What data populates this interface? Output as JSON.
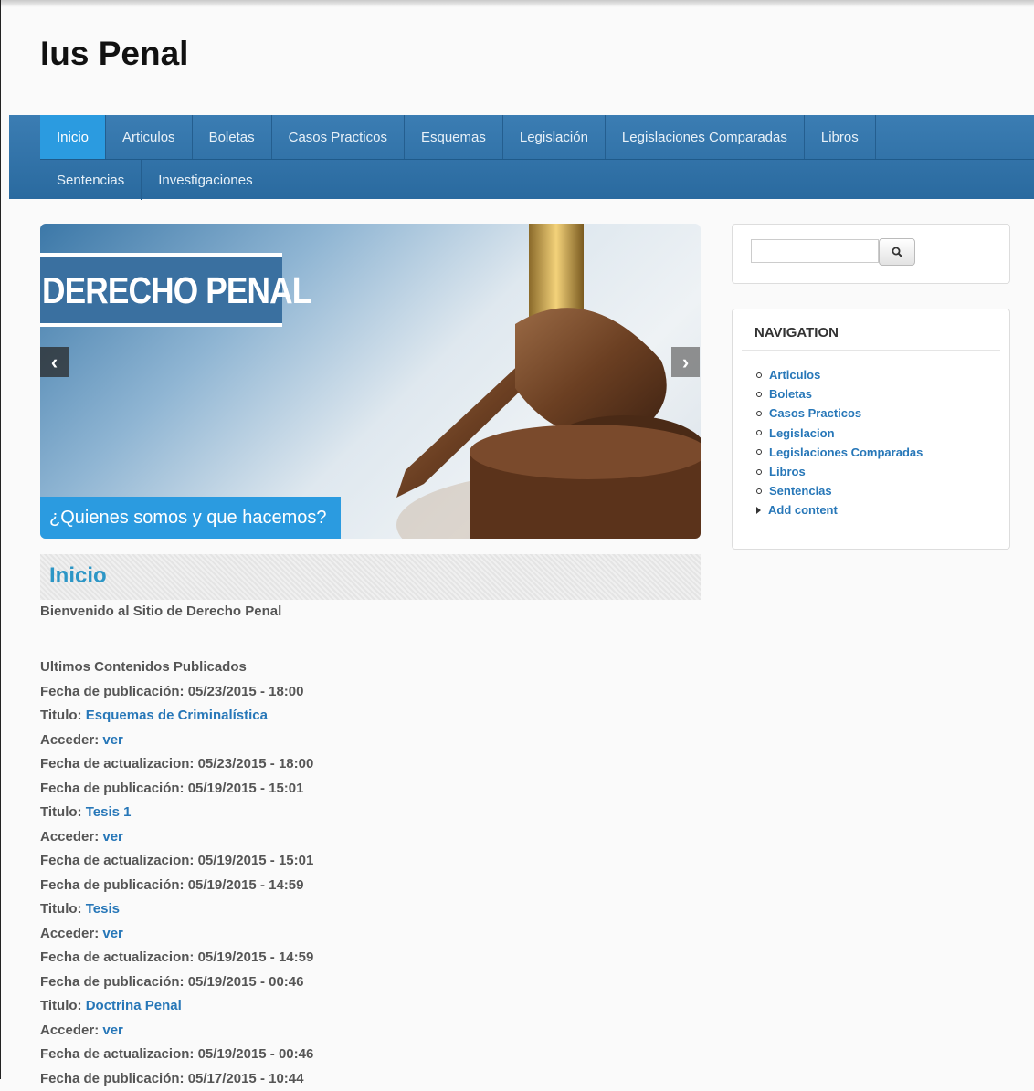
{
  "site": {
    "title": "Ius Penal"
  },
  "main_nav": {
    "row1": [
      "Inicio",
      "Articulos",
      "Boletas",
      "Casos Practicos",
      "Esquemas",
      "Legislación",
      "Legislaciones Comparadas",
      "Libros"
    ],
    "row2": [
      "Sentencias",
      "Investigaciones"
    ],
    "active": "Inicio"
  },
  "slider": {
    "heading": "DERECHO PENAL",
    "caption": "¿Quienes somos y que hacemos?",
    "prev_icon": "chevron-left-icon",
    "next_icon": "chevron-right-icon"
  },
  "page": {
    "title": "Inicio",
    "welcome": "Bienvenido al Sitio de Derecho Penal",
    "section_heading": "Ultimos Contenidos Publicados",
    "labels": {
      "fecha_publicacion": "Fecha de publicación:",
      "titulo": "Titulo:",
      "acceder": "Acceder:",
      "fecha_actualizacion": "Fecha de actualizacion:"
    },
    "entries": [
      {
        "published": "05/23/2015 - 18:00",
        "title": "Esquemas de Criminalística",
        "access": "ver",
        "updated": "05/23/2015 - 18:00"
      },
      {
        "published": "05/19/2015 - 15:01",
        "title": "Tesis 1",
        "access": "ver",
        "updated": "05/19/2015 - 15:01"
      },
      {
        "published": "05/19/2015 - 14:59",
        "title": "Tesis",
        "access": "ver",
        "updated": "05/19/2015 - 14:59"
      },
      {
        "published": "05/19/2015 - 00:46",
        "title": "Doctrina Penal",
        "access": "ver",
        "updated": "05/19/2015 - 00:46"
      }
    ],
    "last_partial": {
      "published": "05/17/2015 - 10:44"
    }
  },
  "search": {
    "value": "",
    "button_icon": "search-icon"
  },
  "sidebar_navigation": {
    "title": "NAVIGATION",
    "items": [
      "Articulos",
      "Boletas",
      "Casos Practicos",
      "Legislacion",
      "Legislaciones Comparadas",
      "Libros",
      "Sentencias"
    ],
    "add_content": "Add content"
  },
  "colors": {
    "nav_bar": "#3379ae",
    "active_tab": "#2b9be0",
    "link": "#2777b8",
    "page_title": "#2c96c6"
  }
}
